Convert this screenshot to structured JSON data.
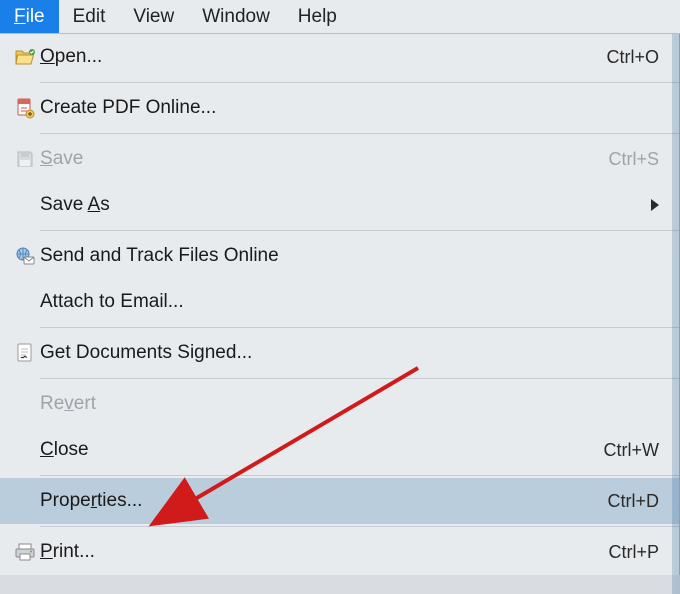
{
  "menubar": {
    "file": "File",
    "edit": "Edit",
    "view": "View",
    "window": "Window",
    "help": "Help"
  },
  "menu": {
    "open": {
      "label": "Open...",
      "shortcut": "Ctrl+O"
    },
    "create_pdf": {
      "label": "Create PDF Online..."
    },
    "save": {
      "label": "Save",
      "shortcut": "Ctrl+S"
    },
    "save_as": {
      "label": "Save As"
    },
    "send_track": {
      "label": "Send and Track Files Online"
    },
    "attach_email": {
      "label": "Attach to Email..."
    },
    "get_signed": {
      "label": "Get Documents Signed..."
    },
    "revert": {
      "label": "Revert"
    },
    "close": {
      "label": "Close",
      "shortcut": "Ctrl+W"
    },
    "properties": {
      "label": "Properties...",
      "shortcut": "Ctrl+D"
    },
    "print": {
      "label": "Print...",
      "shortcut": "Ctrl+P"
    }
  },
  "annotation": {
    "arrow_color": "#d11a1a"
  }
}
